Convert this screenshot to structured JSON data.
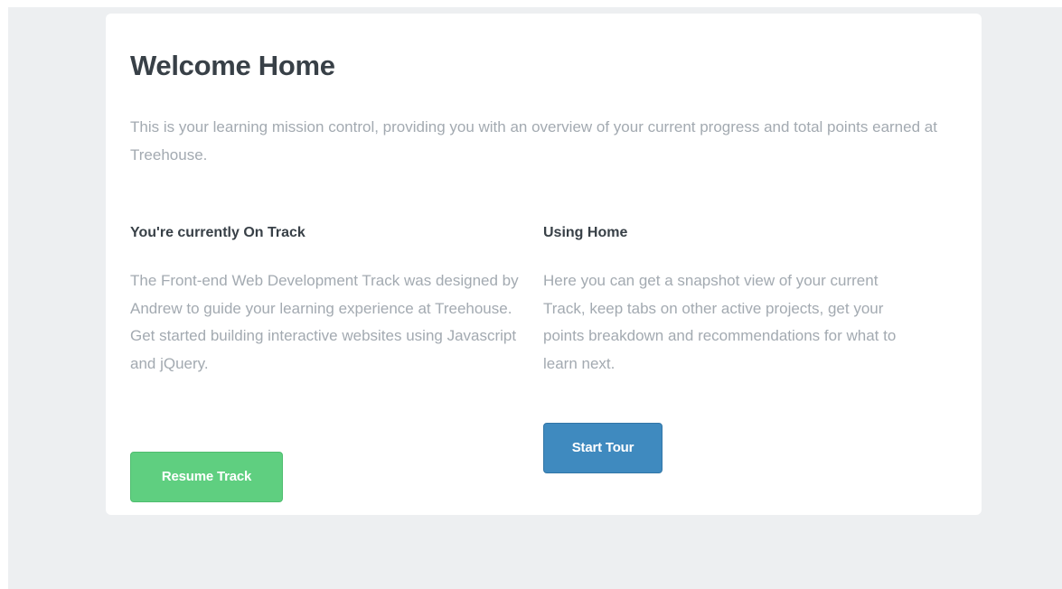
{
  "welcome": {
    "title": "Welcome Home",
    "intro": "This is your learning mission control, providing you with an overview of your current progress and total points earned at Treehouse."
  },
  "track": {
    "heading": "You're currently On Track",
    "description": "The Front-end Web Development Track was designed by Andrew to guide your learning experience at Treehouse. Get started building interactive websites using Javascript and jQuery.",
    "button_label": "Resume Track"
  },
  "using_home": {
    "heading": "Using Home",
    "description": "Here you can get a snapshot view of your current Track, keep tabs on other active projects, get your points breakdown and recommendations for what to learn next.",
    "button_label": "Start Tour"
  },
  "colors": {
    "page_background": "#edeff1",
    "heading_text": "#384047",
    "body_text": "#a3aab1",
    "resume_button": "#5fcf80",
    "tour_button": "#3f8abf"
  }
}
